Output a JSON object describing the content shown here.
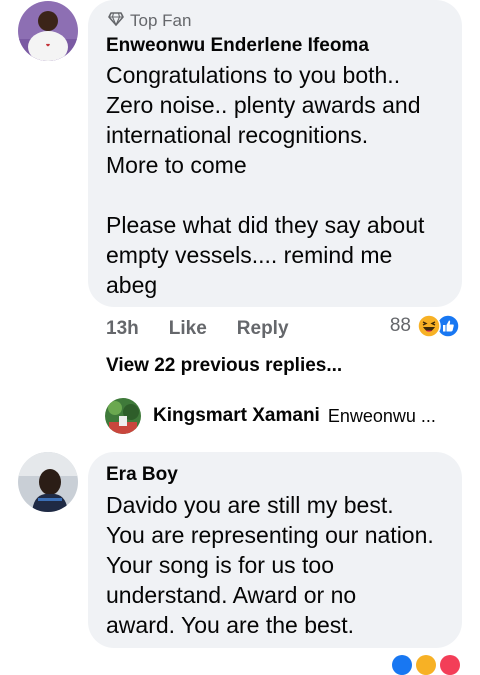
{
  "comment1": {
    "badge": "Top Fan",
    "author": "Enweonwu Enderlene Ifeoma",
    "text": "Congratulations to you both..\nZero noise.. plenty awards and\ninternational recognitions.\nMore to come\n\nPlease what did they say about\nempty vessels.... remind me\nabeg",
    "time": "13h",
    "like": "Like",
    "reply": "Reply",
    "reaction_count": "88"
  },
  "view_previous": "View 22 previous replies...",
  "reply_preview": {
    "author": "Kingsmart Xamani",
    "text": "Enweonwu ..."
  },
  "comment2": {
    "author": "Era Boy",
    "text": "Davido you are still my best.\nYou are representing our nation.\nYour song is for us too\nunderstand.   Award or no\naward.  You are the best."
  },
  "colors": {
    "bubble": "#f0f2f5",
    "like_blue": "#1877f2",
    "haha_yellow": "#f7b125",
    "secondary_text": "#65676b"
  }
}
